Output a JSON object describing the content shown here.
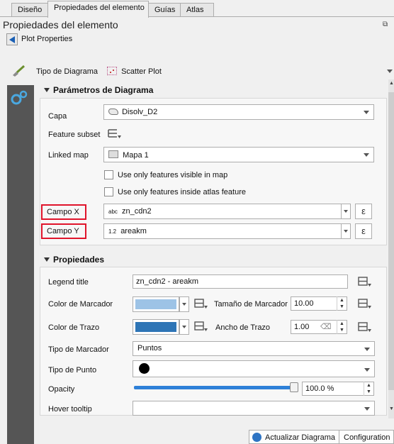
{
  "tabs": [
    {
      "label": "Diseño"
    },
    {
      "label": "Propiedades del elemento"
    },
    {
      "label": "Guías"
    },
    {
      "label": "Atlas"
    }
  ],
  "panel": {
    "title": "Propiedades del elemento",
    "subtitle": "Plot Properties"
  },
  "plot_type": {
    "label": "Tipo de Diagrama",
    "value": "Scatter Plot"
  },
  "diagram_params": {
    "header": "Parámetros de Diagrama",
    "layer_label": "Capa",
    "layer_value": "Disolv_D2",
    "feature_subset_label": "Feature subset",
    "linked_map_label": "Linked map",
    "linked_map_value": "Mapa 1",
    "check_visible": "Use only features visible in map",
    "check_atlas": "Use only features inside atlas feature",
    "x_label": "Campo X",
    "x_type": "abc",
    "x_value": "zn_cdn2",
    "y_label": "Campo Y",
    "y_type": "1.2",
    "y_value": "areakm",
    "epsilon": "ε"
  },
  "properties": {
    "header": "Propiedades",
    "legend_title_label": "Legend title",
    "legend_title_value": "zn_cdn2 - areakm",
    "marker_color_label": "Color de Marcador",
    "marker_size_label": "Tamaño de Marcador",
    "marker_size_value": "10.00",
    "stroke_color_label": "Color de Trazo",
    "stroke_width_label": "Ancho de Trazo",
    "stroke_width_value": "1.00",
    "marker_type_label": "Tipo de Marcador",
    "marker_type_value": "Puntos",
    "point_type_label": "Tipo de Punto",
    "opacity_label": "Opacity",
    "opacity_value": "100.0 %",
    "opacity_fraction": 1.0,
    "hover_label": "Hover tooltip",
    "hover_value": ""
  },
  "footer": {
    "update_button": "Actualizar Diagrama",
    "config_button": "Configuration"
  },
  "colors": {
    "marker_color": "#9dc3e6",
    "stroke_color": "#2e75b6",
    "highlight_border": "#e0142b",
    "sidebar": "#555555"
  }
}
